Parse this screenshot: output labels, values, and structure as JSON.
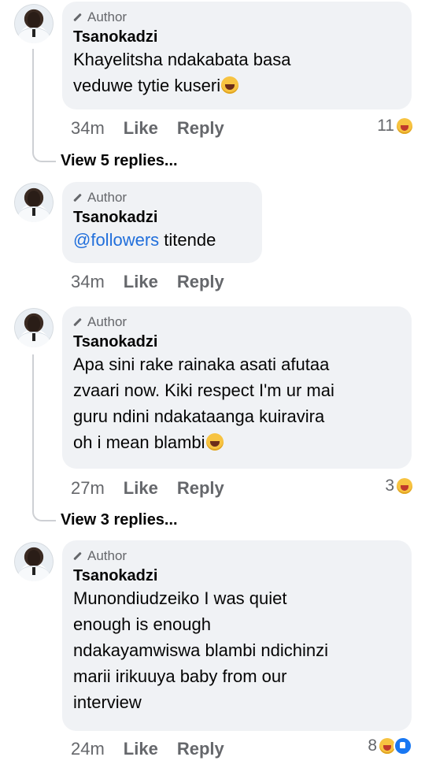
{
  "comments": [
    {
      "author_label": "Author",
      "name": "Tsanokadzi",
      "lines": [
        "Khayelitsha  ndakabata basa",
        "veduwe tytie kuseri"
      ],
      "time": "34m",
      "like": "Like",
      "reply": "Reply",
      "reaction_count": "11",
      "reactions": [
        "haha-icon"
      ],
      "view_replies": "View 5 replies..."
    },
    {
      "author_label": "Author",
      "name": "Tsanokadzi",
      "mention": "@followers",
      "text_after_mention": " titende",
      "time": "34m",
      "like": "Like",
      "reply": "Reply"
    },
    {
      "author_label": "Author",
      "name": "Tsanokadzi",
      "lines": [
        "Apa sini rake rainaka asati afutaa",
        "zvaari now. Kiki respect I'm ur mai",
        "guru ndini ndakataanga kuiravira",
        "oh i mean blambi"
      ],
      "time": "27m",
      "like": "Like",
      "reply": "Reply",
      "reaction_count": "3",
      "reactions": [
        "haha-icon"
      ],
      "view_replies": "View 3 replies..."
    },
    {
      "author_label": "Author",
      "name": "Tsanokadzi",
      "lines": [
        "Munondiudzeiko I was quiet",
        "enough  is enough",
        "ndakayamwiswa blambi ndichinzi",
        "marii irikuuya baby from our",
        "interview"
      ],
      "time": "24m",
      "like": "Like",
      "reply": "Reply",
      "reaction_count": "8",
      "reactions": [
        "haha-icon",
        "like-icon"
      ]
    }
  ],
  "colors": {
    "bubble": "#f0f2f5",
    "meta_text": "#65676b",
    "mention": "#216fdb",
    "like_reaction": "#1877f2"
  }
}
